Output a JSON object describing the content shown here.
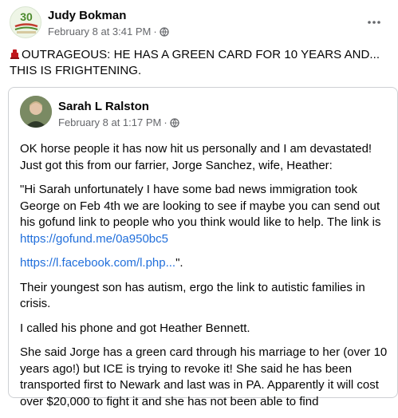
{
  "post": {
    "author": "Judy Bokman",
    "timestamp": "February 8 at 3:41 PM",
    "separator": "·",
    "avatar_text": "30",
    "text": "OUTRAGEOUS: HE HAS A GREEN CARD FOR 10 YEARS AND... THIS IS FRIGHTENING.",
    "more_icon": "more-horizontal-icon",
    "audience_icon": "globe-icon"
  },
  "shared": {
    "author": "Sarah L Ralston",
    "timestamp": "February 8 at 1:17 PM",
    "separator": "·",
    "audience_icon": "globe-icon",
    "p1": "OK horse people it has now hit us personally and I am devastated! Just got this from our farrier, Jorge Sanchez, wife, Heather:",
    "p2_text": "\"Hi Sarah unfortunately I have some bad news immigration took George on Feb 4th we are looking to see if maybe you can send out his gofund link to people who you think would like to help. The link is ",
    "p2_link": "https://gofund.me/0a950bc5",
    "p3_link": "https://l.facebook.com/l.php...",
    "p3_tail": "\".",
    "p4": "Their youngest son has autism, ergo the link to autistic families in crisis.",
    "p5": "I called his phone and got Heather Bennett.",
    "p6": "She said Jorge has a green card through his marriage to her (over 10 years ago!) but ICE is trying to revoke it! She said he has been transported first to Newark and last was in PA. Apparently it will cost over $20,000 to fight it and she has not been able to find"
  },
  "colors": {
    "link": "#216fdb",
    "meta": "#65676b",
    "text": "#050505",
    "accent_red": "#c0161c"
  }
}
